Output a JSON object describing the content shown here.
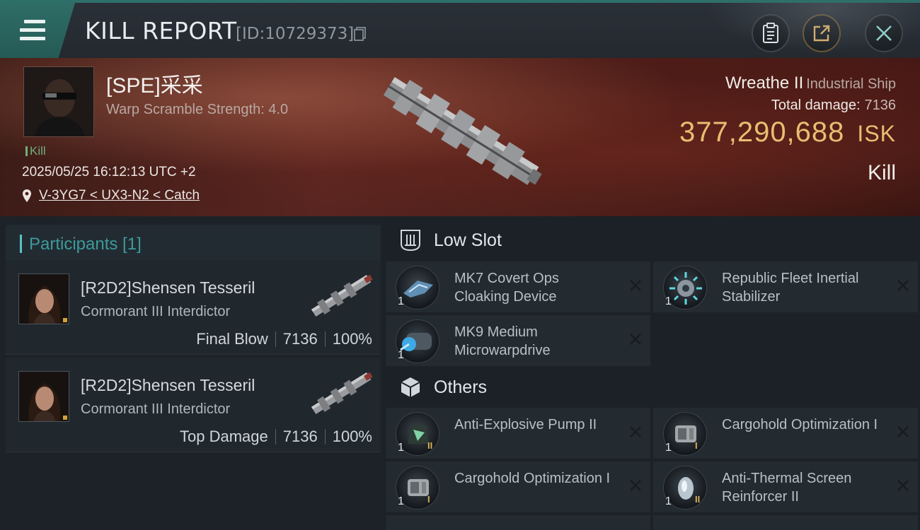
{
  "header": {
    "title": "KILL REPORT",
    "report_id": "[ID:10729373]"
  },
  "victim": {
    "pilot_name": "[SPE]采采",
    "warp_scramble": "Warp Scramble Strength: 4.0",
    "status": "Kill",
    "datetime": "2025/05/25 16:12:13 UTC +2",
    "location": "V-3YG7 < UX3-N2 < Catch",
    "ship_name": "Wreathe II",
    "ship_class": "Industrial Ship",
    "total_damage_label": "Total damage:",
    "total_damage": "7136",
    "isk_value": "377,290,688",
    "isk_unit": "ISK",
    "result": "Kill"
  },
  "participants": {
    "tab_label": "Participants [1]",
    "rows": [
      {
        "name": "[R2D2]Shensen Tesseril",
        "ship": "Cormorant III Interdictor",
        "role": "Final Blow",
        "damage": "7136",
        "percent": "100%"
      },
      {
        "name": "[R2D2]Shensen Tesseril",
        "ship": "Cormorant III Interdictor",
        "role": "Top Damage",
        "damage": "7136",
        "percent": "100%"
      }
    ]
  },
  "fitting": {
    "low_slot_label": "Low Slot",
    "others_label": "Others",
    "low_slot": [
      {
        "name": "MK7 Covert Ops Cloaking Device",
        "qty": "1",
        "meta": "",
        "icon": "cloaking-device-icon"
      },
      {
        "name": "Republic Fleet Inertial Stabilizer",
        "qty": "1",
        "meta": "",
        "icon": "inertial-stabilizer-icon"
      },
      {
        "name": "MK9 Medium Microwarpdrive",
        "qty": "1",
        "meta": "",
        "icon": "microwarpdrive-icon"
      }
    ],
    "others": [
      {
        "name": "Anti-Explosive Pump II",
        "qty": "1",
        "meta": "II",
        "icon": "rig-pump-icon"
      },
      {
        "name": "Cargohold Optimization I",
        "qty": "1",
        "meta": "I",
        "icon": "cargohold-icon"
      },
      {
        "name": "Cargohold Optimization I",
        "qty": "1",
        "meta": "I",
        "icon": "cargohold-icon"
      },
      {
        "name": "Anti-Thermal Screen Reinforcer II",
        "qty": "1",
        "meta": "II",
        "icon": "screen-reinforcer-icon"
      }
    ]
  },
  "colors": {
    "accent_teal": "#2f6d67",
    "isk_gold": "#e8be72",
    "kill_green": "#6fae79"
  }
}
